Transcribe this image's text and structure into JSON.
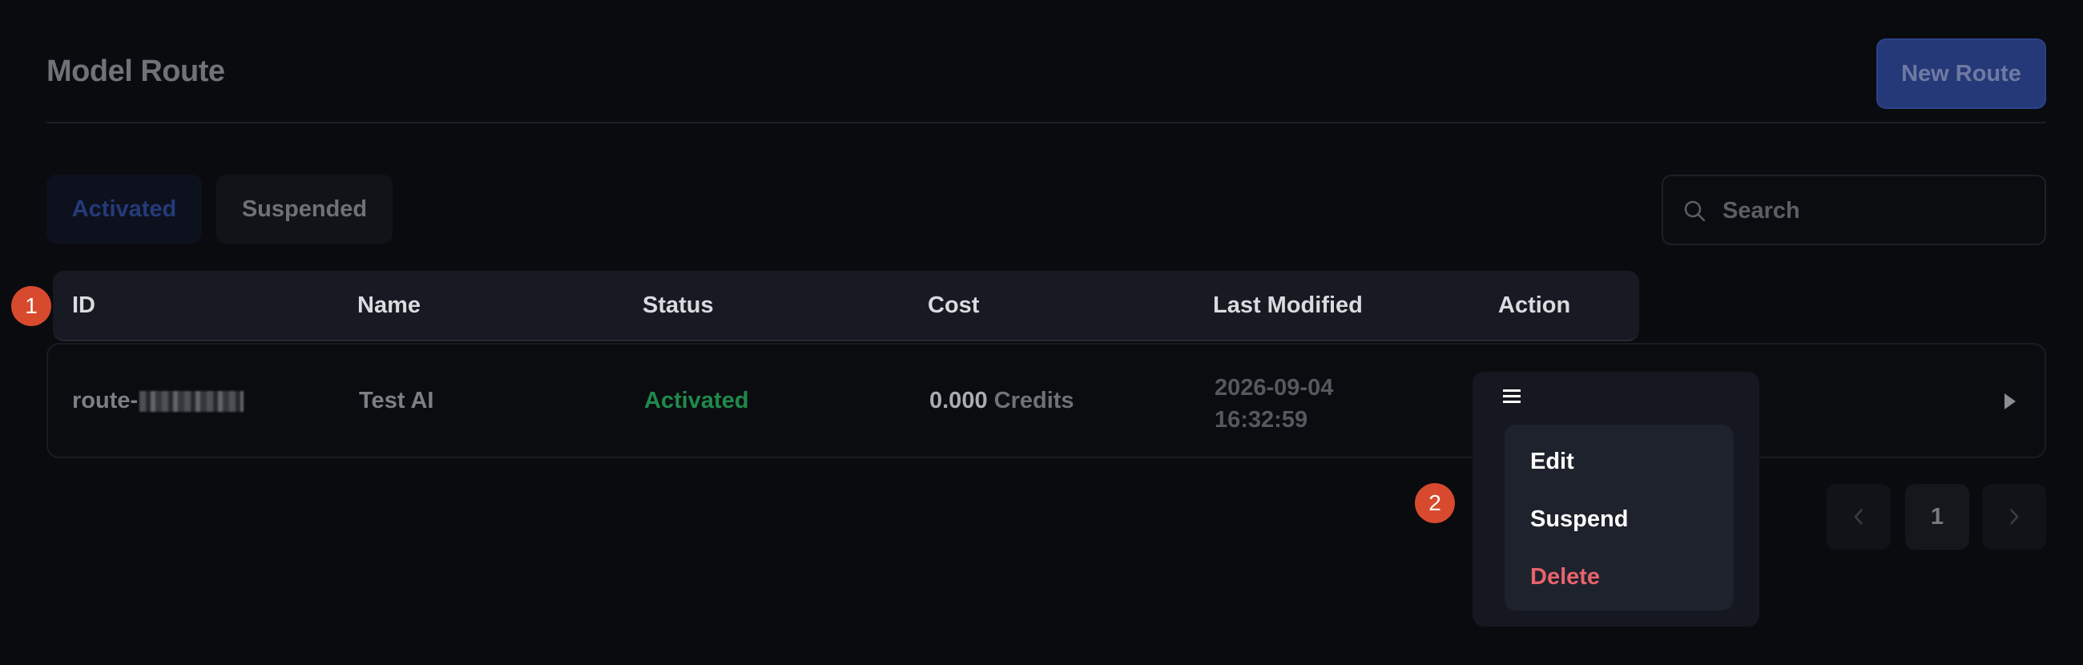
{
  "header": {
    "title": "Model Route",
    "new_button_label": "New Route"
  },
  "tabs": [
    {
      "label": "Activated",
      "active": true
    },
    {
      "label": "Suspended",
      "active": false
    }
  ],
  "search": {
    "placeholder": "Search",
    "value": ""
  },
  "table": {
    "columns": [
      "ID",
      "Name",
      "Status",
      "Cost",
      "Last Modified",
      "Action"
    ],
    "rows": [
      {
        "id_prefix": "route-",
        "name": "Test AI",
        "status": "Activated",
        "cost_value": "0.000",
        "cost_unit": "Credits",
        "last_modified_date": "2026-09-04",
        "last_modified_time": "16:32:59"
      }
    ]
  },
  "action_menu": {
    "items": [
      "Edit",
      "Suspend",
      "Delete"
    ]
  },
  "pagination": {
    "current_page": "1"
  },
  "annotations": {
    "badge_1": "1",
    "badge_2": "2"
  },
  "colors": {
    "background": "#0a0b0f",
    "primary": "#253878",
    "status_active": "#1f8a4a",
    "danger": "#e8636d",
    "badge": "#d84a2e"
  },
  "icons": {
    "search": "search-icon",
    "menu": "menu-icon",
    "row_expand": "chevron-right-icon",
    "prev": "chevron-left-icon",
    "next": "chevron-right-icon"
  }
}
